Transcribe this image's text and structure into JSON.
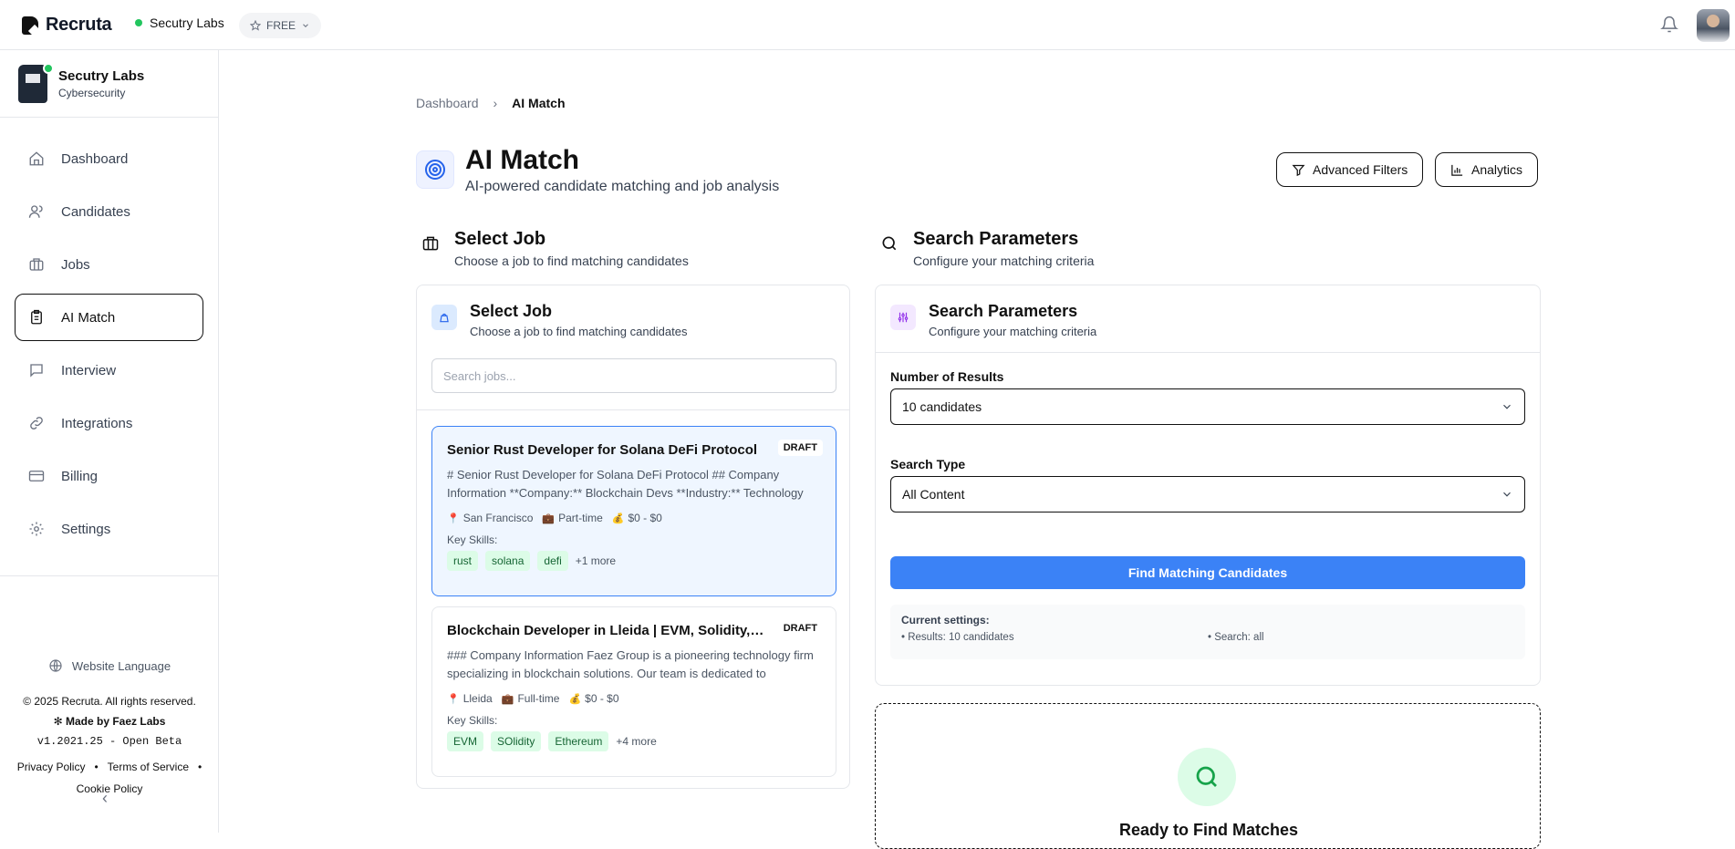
{
  "app": {
    "name": "Recruta",
    "org": "Secutry Labs",
    "plan": "FREE"
  },
  "sidebar": {
    "org_name": "Secutry Labs",
    "org_sub": "Cybersecurity",
    "items": [
      {
        "label": "Dashboard"
      },
      {
        "label": "Candidates"
      },
      {
        "label": "Jobs"
      },
      {
        "label": "AI Match"
      },
      {
        "label": "Interview"
      },
      {
        "label": "Integrations"
      },
      {
        "label": "Billing"
      },
      {
        "label": "Settings"
      }
    ],
    "language": "Website Language",
    "copyright": "© 2025 Recruta. All rights reserved.",
    "made_by": "Made by Faez Labs",
    "version": "v1.2021.25 - Open Beta",
    "privacy": "Privacy Policy",
    "terms": "Terms of Service",
    "cookie": "Cookie Policy",
    "collapse": "‹"
  },
  "breadcrumb": {
    "parent": "Dashboard",
    "sep": "›",
    "current": "AI Match"
  },
  "page": {
    "title": "AI Match",
    "subtitle": "AI-powered candidate matching and job analysis",
    "advanced_filters": "Advanced Filters",
    "analytics": "Analytics"
  },
  "select_job_section": {
    "title": "Select Job",
    "subtitle": "Choose a job to find matching candidates"
  },
  "search_section": {
    "title": "Search Parameters",
    "subtitle": "Configure your matching criteria"
  },
  "job_panel": {
    "title": "Select Job",
    "subtitle": "Choose a job to find matching candidates",
    "search_placeholder": "Search jobs...",
    "key_skills_label": "Key Skills:",
    "jobs": [
      {
        "title": "Senior Rust Developer for Solana DeFi Protocol",
        "status": "DRAFT",
        "desc": "# Senior Rust Developer for Solana DeFi Protocol ## Company Information **Company:** Blockchain Devs **Industry:** Technology",
        "location": "San Francisco",
        "type": "Part-time",
        "salary": "$0 - $0",
        "skills": [
          "rust",
          "solana",
          "defi"
        ],
        "more": "+1 more"
      },
      {
        "title": "Blockchain Developer in Lleida | EVM, Solidity, Ethereum",
        "status": "DRAFT",
        "desc": "### Company Information Faez Group is a pioneering technology firm specializing in blockchain solutions. Our team is dedicated to",
        "location": "Lleida",
        "type": "Full-time",
        "salary": "$0 - $0",
        "skills": [
          "EVM",
          "SOlidity",
          "Ethereum"
        ],
        "more": "+4 more"
      }
    ]
  },
  "params_panel": {
    "title": "Search Parameters",
    "subtitle": "Configure your matching criteria",
    "num_results_label": "Number of Results",
    "num_results_value": "10 candidates",
    "search_type_label": "Search Type",
    "search_type_value": "All Content",
    "find_button": "Find Matching Candidates",
    "current_settings_label": "Current settings:",
    "current_results": "• Results: 10 candidates",
    "current_search": "• Search: all"
  },
  "empty_state": {
    "title": "Ready to Find Matches"
  },
  "colors": {
    "primary": "#3b82f6",
    "skill_bg": "#dcfce7",
    "skill_text": "#166534",
    "online": "#22c55e"
  }
}
